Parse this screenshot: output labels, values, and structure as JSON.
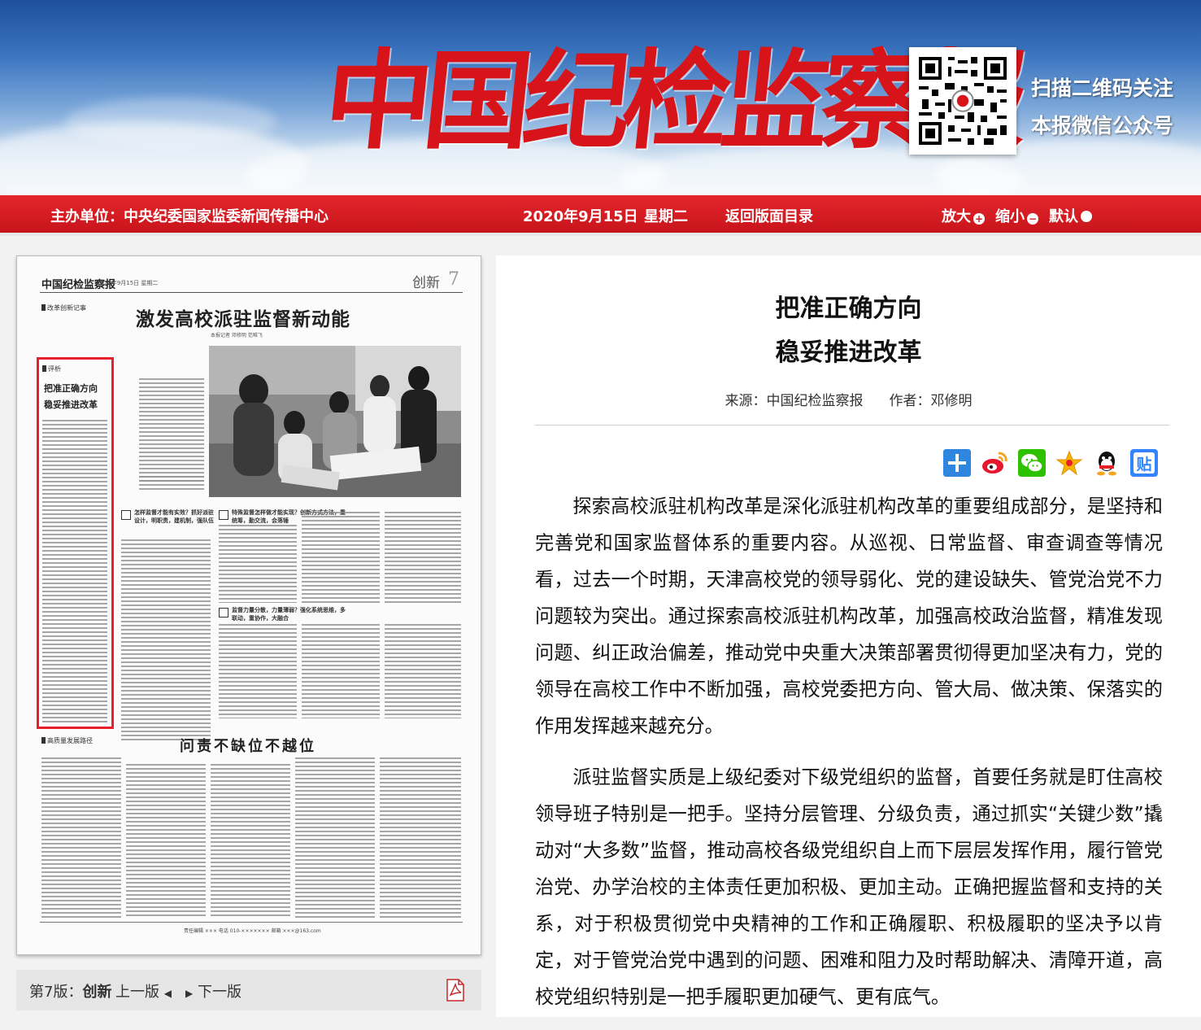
{
  "banner": {
    "masthead": "中国纪检监察报",
    "qr_caption_line1": "扫描二维码关注",
    "qr_caption_line2": "本报微信公众号"
  },
  "topbar": {
    "sponsor": "主办单位：中央纪委国家监委新闻传播中心",
    "date": "2020年9月15日",
    "weekday": "星期二",
    "back_link": "返回版面目录",
    "zoom_in": "放大",
    "zoom_out": "缩小",
    "default": "默认"
  },
  "paper_page": {
    "logo": "中国纪检监察报",
    "date": "2020年9月15日  星期二",
    "section": "创新",
    "page_number": "7",
    "tag_top": "改革创新记事",
    "headline": "激发高校派驻监督新动能",
    "byline": "本报记者 邓修明 范唯飞",
    "highlight_kicker": "评析",
    "highlight_title_line1": "把准正确方向",
    "highlight_title_line2": "稳妥推进改革",
    "q1": "怎样监督才能有实效？抓好派驻设计，明职责，建机制，强队伍",
    "q2": "特殊监督怎样做才能实现？创新方式方法，重统筹，勤交流，会落锤",
    "q3": "监督力量分散，力量薄弱？强化系统思维，多联动，重协作，大融合",
    "tag_bottom": "高质量发展路径",
    "headline2": "问责不缺位不越位",
    "footer": "责任编辑 ×××   电话 010-×××××××   邮箱 ×××@163.com"
  },
  "pager": {
    "page_label": "第7版：",
    "section": "创新",
    "prev": "上一版",
    "next": "下一版"
  },
  "article": {
    "title_line1": "把准正确方向",
    "title_line2": "稳妥推进改革",
    "source_label": "来源：",
    "source": "中国纪检监察报",
    "author_label": "作者：",
    "author": "邓修明",
    "paragraphs": [
      "探索高校派驻机构改革是深化派驻机构改革的重要组成部分，是坚持和完善党和国家监督体系的重要内容。从巡视、日常监督、审查调查等情况看，过去一个时期，天津高校党的领导弱化、党的建设缺失、管党治党不力问题较为突出。通过探索高校派驻机构改革，加强高校政治监督，精准发现问题、纠正政治偏差，推动党中央重大决策部署贯彻得更加坚决有力，党的领导在高校工作中不断加强，高校党委把方向、管大局、做决策、保落实的作用发挥越来越充分。",
      "派驻监督实质是上级纪委对下级党组织的监督，首要任务就是盯住高校领导班子特别是一把手。坚持分层管理、分级负责，通过抓实“关键少数”撬动对“大多数”监督，推动高校各级党组织自上而下层层发挥作用，履行管党治党、办学治校的主体责任更加积极、更加主动。正确把握监督和支持的关系，对于积极贯彻党中央精神的工作和正确履职、积极履职的坚决予以肯定，对于管党治党中遇到的问题、困难和阻力及时帮助解决、清障开道，高校党组织特别是一把手履职更加硬气、更有底气。"
    ]
  },
  "share_icons": [
    "plus-icon",
    "weibo-icon",
    "wechat-icon",
    "favorite-star-icon",
    "qq-icon",
    "tieba-icon"
  ],
  "colors": {
    "brand_red": "#d7141a",
    "bar_red": "#d91d23",
    "highlight_red": "#e8202a"
  }
}
